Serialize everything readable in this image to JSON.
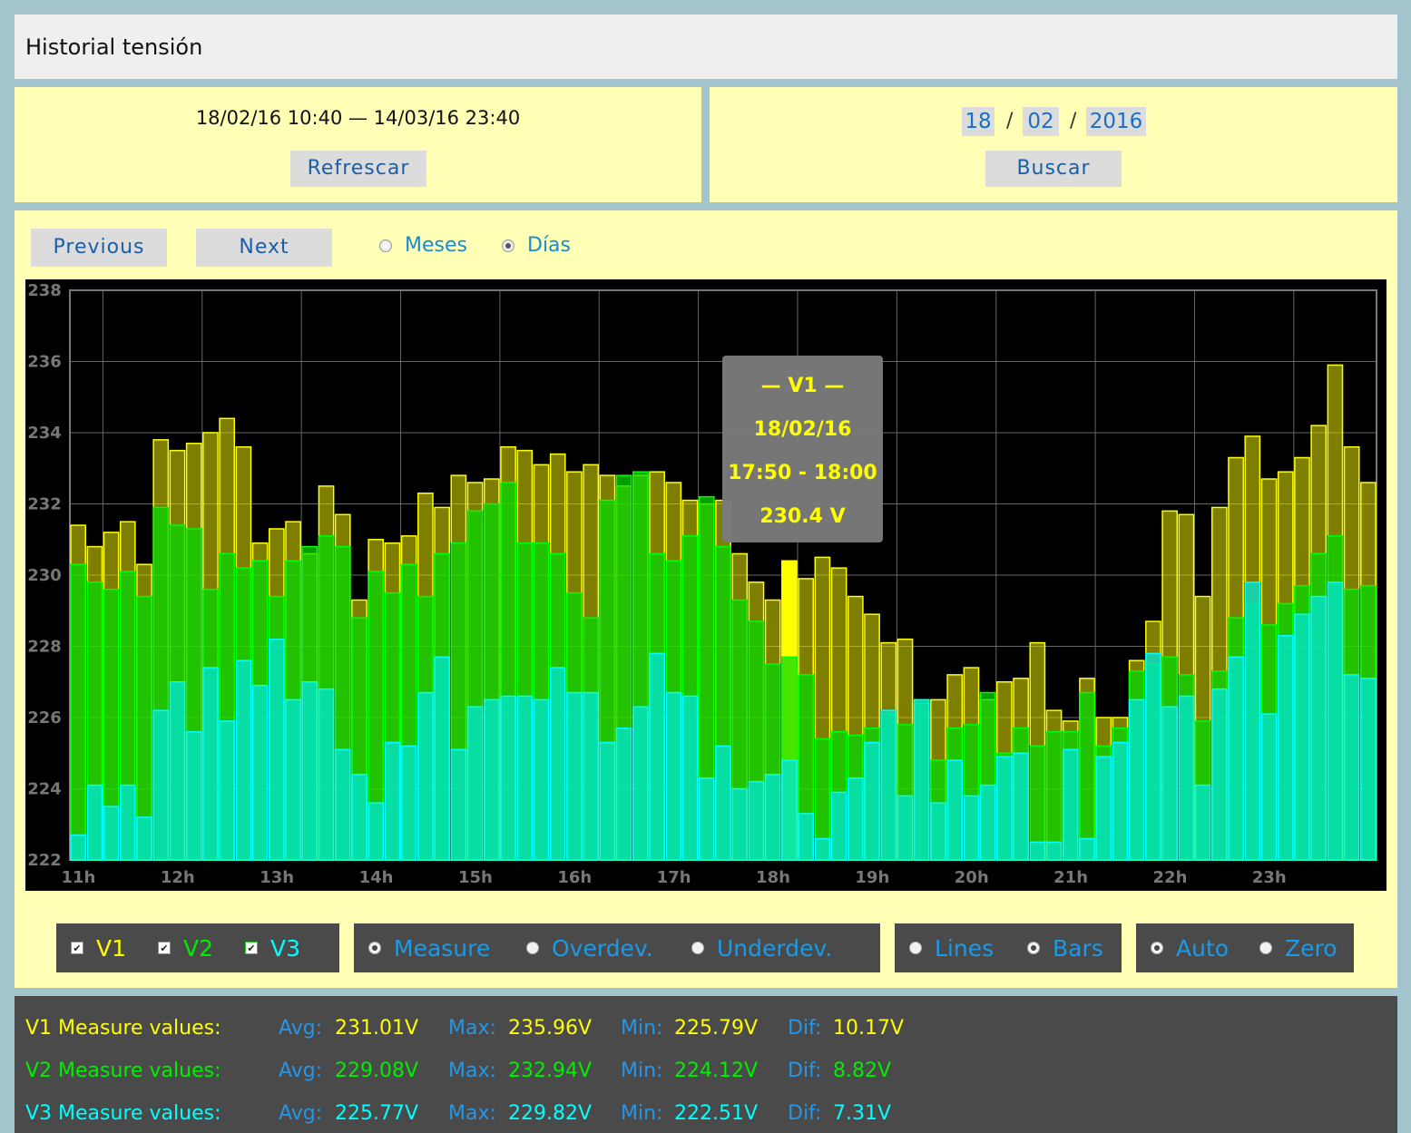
{
  "header": {
    "title": "Historial tensión"
  },
  "range": {
    "text": "18/02/16 10:40 — 14/03/16 23:40",
    "refresh_label": "Refrescar"
  },
  "date_search": {
    "day": "18",
    "month": "02",
    "year": "2016",
    "separator": "/",
    "search_label": "Buscar"
  },
  "nav": {
    "previous_label": "Previous",
    "next_label": "Next",
    "mode_options": [
      {
        "label": "Meses",
        "selected": false
      },
      {
        "label": "Días",
        "selected": true
      }
    ]
  },
  "chart_data": {
    "type": "bar",
    "title": "",
    "xlabel": "",
    "ylabel": "",
    "ylim": [
      222,
      238
    ],
    "yticks": [
      222,
      224,
      226,
      228,
      230,
      232,
      234,
      236,
      238
    ],
    "hour_ticks": [
      "11h",
      "12h",
      "13h",
      "14h",
      "15h",
      "16h",
      "17h",
      "18h",
      "19h",
      "20h",
      "21h",
      "22h",
      "23h"
    ],
    "x_start_hour": 10.667,
    "interval_minutes": 10,
    "grid": true,
    "series": [
      {
        "name": "V1",
        "color": "#ffff00",
        "values": [
          231.4,
          230.8,
          231.2,
          231.5,
          230.3,
          233.8,
          233.5,
          233.7,
          234.0,
          234.4,
          233.6,
          230.9,
          231.3,
          231.5,
          230.6,
          232.5,
          231.7,
          229.3,
          231.0,
          230.9,
          231.1,
          232.3,
          231.9,
          232.8,
          232.6,
          232.7,
          233.6,
          233.5,
          233.1,
          233.4,
          232.9,
          233.1,
          232.8,
          232.5,
          232.8,
          232.9,
          232.6,
          232.1,
          232.0,
          232.1,
          230.6,
          229.8,
          229.3,
          230.4,
          229.9,
          230.5,
          230.2,
          229.4,
          228.9,
          228.1,
          228.2,
          226.4,
          226.5,
          227.2,
          227.4,
          226.5,
          227.0,
          227.1,
          228.1,
          226.2,
          225.9,
          227.1,
          226.0,
          226.0,
          227.6,
          228.7,
          231.8,
          231.7,
          229.4,
          231.9,
          233.3,
          233.9,
          232.7,
          232.9,
          233.3,
          234.2,
          235.9,
          233.6,
          232.6
        ]
      },
      {
        "name": "V2",
        "color": "#00ff00",
        "values": [
          230.3,
          229.8,
          229.6,
          230.1,
          229.4,
          231.9,
          231.4,
          231.3,
          229.6,
          230.6,
          230.2,
          230.4,
          229.4,
          230.4,
          230.8,
          231.1,
          230.8,
          228.8,
          230.1,
          229.5,
          230.3,
          229.4,
          230.6,
          230.9,
          231.8,
          232.0,
          232.6,
          230.9,
          230.9,
          230.6,
          229.5,
          228.8,
          232.1,
          232.8,
          232.9,
          230.6,
          230.4,
          231.1,
          232.2,
          230.8,
          229.3,
          228.7,
          227.5,
          227.7,
          227.2,
          225.4,
          225.6,
          225.5,
          225.7,
          226.1,
          225.8,
          226.5,
          224.8,
          225.7,
          225.8,
          226.7,
          225.0,
          225.7,
          225.2,
          225.6,
          225.6,
          226.7,
          225.2,
          225.7,
          227.3,
          227.5,
          227.7,
          227.2,
          225.9,
          227.3,
          228.8,
          229.2,
          228.6,
          229.2,
          229.7,
          230.6,
          231.1,
          229.6,
          229.7
        ]
      },
      {
        "name": "V3",
        "color": "#00ffff",
        "values": [
          222.7,
          224.1,
          223.5,
          224.1,
          223.2,
          226.2,
          227.0,
          225.6,
          227.4,
          225.9,
          227.6,
          226.9,
          228.2,
          226.5,
          227.0,
          226.8,
          225.1,
          224.4,
          223.6,
          225.3,
          225.2,
          226.7,
          227.7,
          225.1,
          226.3,
          226.5,
          226.6,
          226.6,
          226.5,
          227.4,
          226.7,
          226.7,
          225.3,
          225.7,
          226.3,
          227.8,
          226.7,
          226.6,
          224.3,
          225.2,
          224.0,
          224.2,
          224.4,
          224.8,
          223.3,
          222.6,
          223.9,
          224.3,
          225.3,
          226.2,
          223.8,
          226.5,
          223.6,
          224.8,
          223.8,
          224.1,
          224.9,
          225.0,
          222.5,
          222.5,
          225.1,
          222.6,
          224.9,
          225.3,
          226.5,
          227.8,
          226.3,
          226.6,
          224.1,
          226.8,
          227.7,
          229.8,
          226.1,
          228.3,
          228.9,
          229.4,
          229.8,
          227.2,
          227.1
        ]
      }
    ],
    "highlight": {
      "series": "V1",
      "index": 43
    },
    "tooltip": {
      "title": "— V1 —",
      "date": "18/02/16",
      "time": "17:50 - 18:00",
      "value": "230.4 V"
    }
  },
  "controls": {
    "series_toggles": [
      {
        "label": "V1",
        "color": "#ffff00",
        "checked": true
      },
      {
        "label": "V2",
        "color": "#00ee00",
        "checked": true
      },
      {
        "label": "V3",
        "color": "#00ffff",
        "checked": true
      }
    ],
    "value_modes": [
      {
        "label": "Measure",
        "selected": true
      },
      {
        "label": "Overdev.",
        "selected": false
      },
      {
        "label": "Underdev.",
        "selected": false
      }
    ],
    "plot_styles": [
      {
        "label": "Lines",
        "selected": false
      },
      {
        "label": "Bars",
        "selected": true
      }
    ],
    "scale_modes": [
      {
        "label": "Auto",
        "selected": true
      },
      {
        "label": "Zero",
        "selected": false
      }
    ]
  },
  "stats": {
    "rows": [
      {
        "title": "V1 Measure values:",
        "color": "#ffff00",
        "avg_label": "Avg:",
        "avg": "231.01V",
        "max_label": "Max:",
        "max": "235.96V",
        "min_label": "Min:",
        "min": "225.79V",
        "dif_label": "Dif:",
        "dif": "10.17V"
      },
      {
        "title": "V2 Measure values:",
        "color": "#00ee00",
        "avg_label": "Avg:",
        "avg": "229.08V",
        "max_label": "Max:",
        "max": "232.94V",
        "min_label": "Min:",
        "min": "224.12V",
        "dif_label": "Dif:",
        "dif": "8.82V"
      },
      {
        "title": "V3 Measure values:",
        "color": "#00ffff",
        "avg_label": "Avg:",
        "avg": "225.77V",
        "max_label": "Max:",
        "max": "229.82V",
        "min_label": "Min:",
        "min": "222.51V",
        "dif_label": "Dif:",
        "dif": "7.31V"
      }
    ]
  }
}
